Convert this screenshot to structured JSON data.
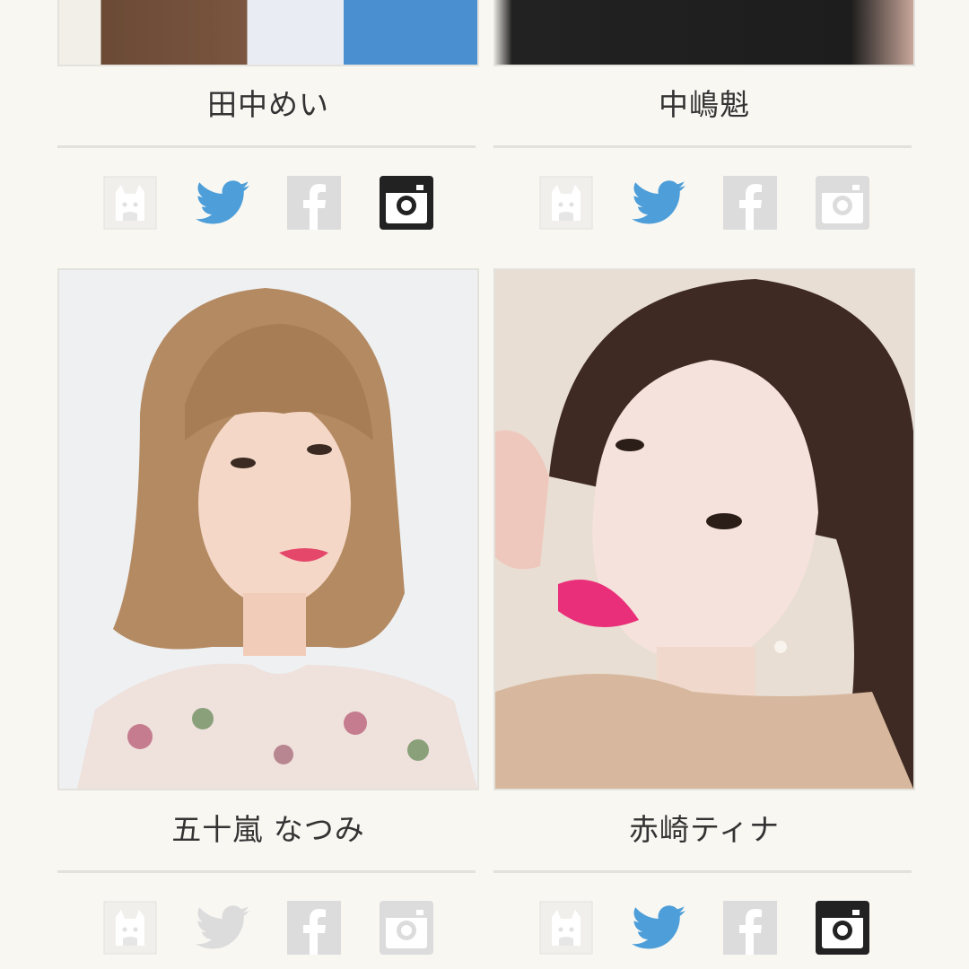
{
  "profiles": [
    {
      "name": "田中めい",
      "sns": [
        {
          "icon": "blog-icon",
          "active": false
        },
        {
          "icon": "twitter-icon",
          "active": true
        },
        {
          "icon": "facebook-icon",
          "active": false
        },
        {
          "icon": "instagram-icon",
          "active": true
        }
      ]
    },
    {
      "name": "中嶋魁",
      "sns": [
        {
          "icon": "blog-icon",
          "active": false
        },
        {
          "icon": "twitter-icon",
          "active": true
        },
        {
          "icon": "facebook-icon",
          "active": false
        },
        {
          "icon": "instagram-icon",
          "active": false
        }
      ]
    },
    {
      "name": "五十嵐 なつみ",
      "sns": [
        {
          "icon": "blog-icon",
          "active": false
        },
        {
          "icon": "twitter-icon",
          "active": false
        },
        {
          "icon": "facebook-icon",
          "active": false
        },
        {
          "icon": "instagram-icon",
          "active": false
        }
      ]
    },
    {
      "name": "赤崎ティナ",
      "sns": [
        {
          "icon": "blog-icon",
          "active": false
        },
        {
          "icon": "twitter-icon",
          "active": true
        },
        {
          "icon": "facebook-icon",
          "active": false
        },
        {
          "icon": "instagram-icon",
          "active": true
        }
      ]
    }
  ],
  "colors": {
    "background": "#f8f7f2",
    "twitter": "#4d9ed9",
    "instagram_active": "#222222",
    "inactive_icon": "#dcdcdc"
  }
}
